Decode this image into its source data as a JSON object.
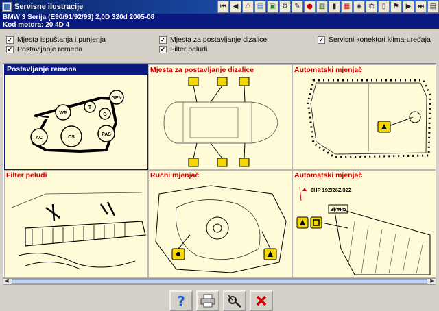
{
  "window": {
    "title": "Servisne ilustracije"
  },
  "toolbar": {
    "icons": [
      "first-icon",
      "prev-icon",
      "warning-icon",
      "book-icon",
      "image-icon",
      "gear-icon",
      "wrench-icon",
      "stop-icon",
      "chart-icon",
      "battery-icon",
      "print-icon",
      "engine-icon",
      "scale-icon",
      "fuse-icon",
      "flag-icon",
      "next-icon",
      "last-icon",
      "lock-icon"
    ]
  },
  "vehicle": {
    "model_line": "BMW   3 Serija (E90/91/92/93) 2,0D 320d 2005-08",
    "engine_line": "Kod motora: 20 4D 4"
  },
  "options": [
    {
      "label": "Mjesta ispuštanja i punjenja",
      "checked": true
    },
    {
      "label": "Postavljanje remena",
      "checked": true
    },
    {
      "label": "Mjesta za postavljanje dizalice",
      "checked": true
    },
    {
      "label": "Filter peludi",
      "checked": true
    },
    {
      "label": "Servisni konektori klima-uređaja",
      "checked": true
    }
  ],
  "panels": [
    {
      "title": "Postavljanje remena",
      "selected": true,
      "labels": [
        "GEN",
        "WP",
        "T",
        "G",
        "AC",
        "CS",
        "PAS"
      ]
    },
    {
      "title": "Mjesta za postavljanje dizalice",
      "selected": false
    },
    {
      "title": "Automatski mjenjač",
      "selected": false
    },
    {
      "title": "Filter peludi",
      "selected": false
    },
    {
      "title": "Ručni mjenjač",
      "selected": false
    },
    {
      "title": "Automatski mjenjač",
      "selected": false,
      "labels": [
        "6HP 19Z/26Z/32Z",
        "35 Nm"
      ]
    }
  ],
  "buttons": {
    "help": "help-icon",
    "print": "printer-icon",
    "tool": "tool-icon",
    "close": "close-icon"
  }
}
